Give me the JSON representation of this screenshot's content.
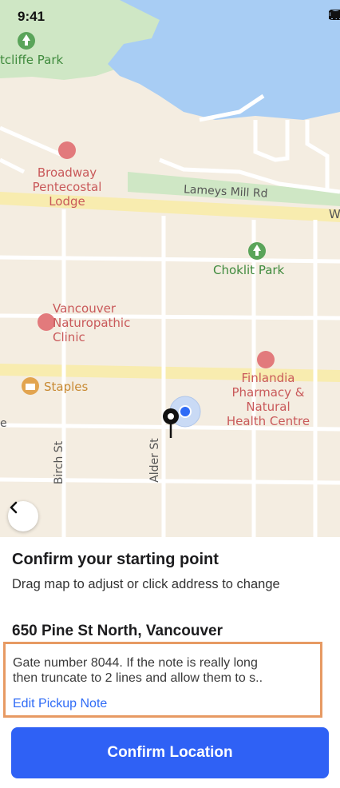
{
  "status_bar": {
    "time": "9:41"
  },
  "map": {
    "labels": {
      "park_top": "tcliffe Park",
      "broadway_1": "Broadway",
      "broadway_2": "Pentecostal",
      "broadway_3": "Lodge",
      "lameys": "Lameys Mill Rd",
      "w": "W",
      "choklit": "Choklit Park",
      "vancouver_1": "Vancouver",
      "vancouver_2": "Naturopathic",
      "vancouver_3": "Clinic",
      "staples": "Staples",
      "finlandia_1": "Finlandia",
      "finlandia_2": "Pharmacy &",
      "finlandia_3": "Natural",
      "finlandia_4": "Health Centre",
      "edge_e": "e",
      "birch": "Birch St",
      "alder": "Alder St"
    },
    "colors": {
      "water": "#a8cdf4",
      "park": "#cfe7c5",
      "road": "#ffffff",
      "major_road": "#f8ecaf",
      "land": "#f4ede1"
    }
  },
  "sheet": {
    "title": "Confirm your starting point",
    "subtitle": "Drag map to adjust or click address to change",
    "address": "650 Pine St North, Vancouver",
    "note_line1": "Gate number 8044. If the note is really long",
    "note_line2": "then truncate to 2 lines and allow them to s..",
    "edit_link": "Edit Pickup Note",
    "confirm_button": "Confirm Location"
  }
}
